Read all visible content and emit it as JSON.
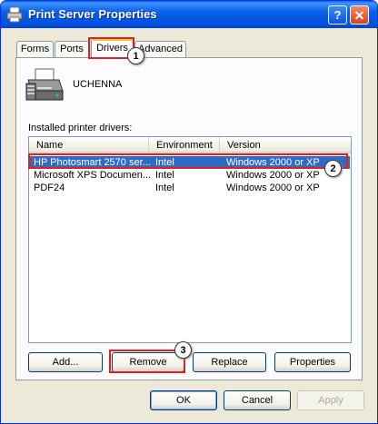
{
  "window": {
    "title": "Print Server Properties",
    "help_label": "?",
    "close_label": "✕"
  },
  "tabs": [
    {
      "label": "Forms"
    },
    {
      "label": "Ports"
    },
    {
      "label": "Drivers"
    },
    {
      "label": "Advanced"
    }
  ],
  "active_tab": "Drivers",
  "server": {
    "name": "UCHENNA",
    "icon": "printer-server-icon"
  },
  "drivers": {
    "label": "Installed printer drivers:",
    "columns": [
      "Name",
      "Environment",
      "Version"
    ],
    "rows": [
      {
        "name": "HP Photosmart 2570 ser...",
        "environment": "Intel",
        "version": "Windows 2000 or XP",
        "selected": true
      },
      {
        "name": "Microsoft XPS Documen...",
        "environment": "Intel",
        "version": "Windows 2000 or XP",
        "selected": false
      },
      {
        "name": "PDF24",
        "environment": "Intel",
        "version": "Windows 2000 or XP",
        "selected": false
      }
    ]
  },
  "panel_buttons": {
    "add": "Add...",
    "remove": "Remove",
    "replace": "Replace",
    "properties": "Properties"
  },
  "dialog_buttons": {
    "ok": "OK",
    "cancel": "Cancel",
    "apply": "Apply"
  },
  "callouts": [
    "1",
    "2",
    "3"
  ],
  "colors": {
    "highlight": "#e02020",
    "selection": "#316ac5",
    "titlebar": "#0054e3"
  }
}
